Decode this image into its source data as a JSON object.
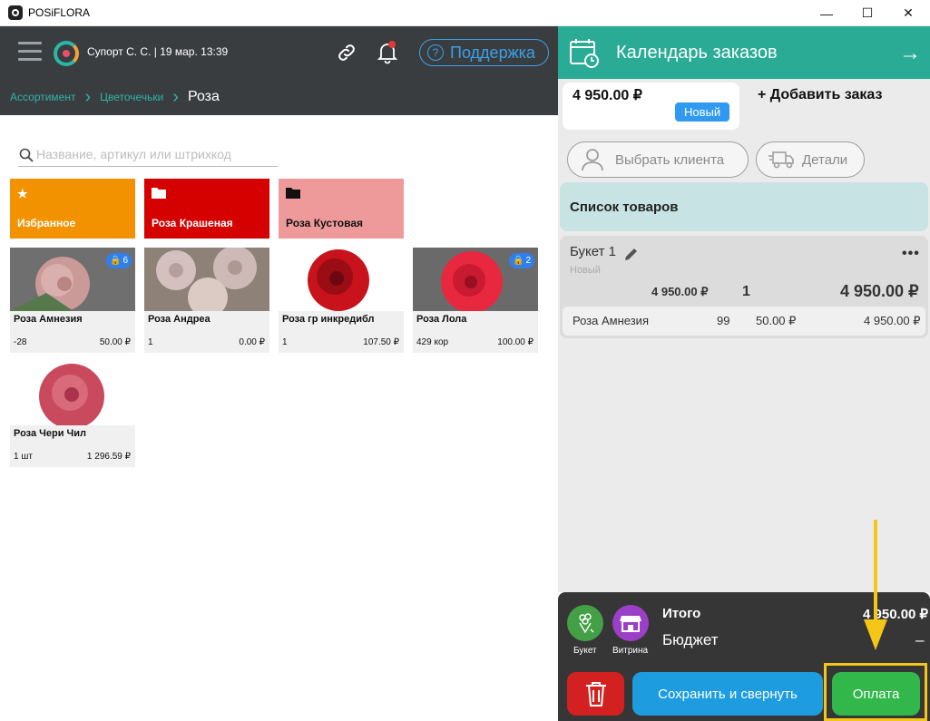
{
  "window": {
    "title": "POSiFLORA",
    "minimize": "—",
    "maximize": "☐",
    "close": "✕"
  },
  "header": {
    "user_info": "Супорт С. С. | 19 мар. 13:39",
    "support_label": "Поддержка",
    "support_icon": "?"
  },
  "breadcrumb": {
    "items": [
      "Ассортимент",
      "Цветочечьки"
    ],
    "current": "Роза"
  },
  "search": {
    "placeholder": "Название, артикул или штрихкод"
  },
  "folders": [
    {
      "label": "Избранное",
      "icon": "★",
      "color": "#f39200"
    },
    {
      "label": "Роза Крашеная",
      "icon": "folder-icon",
      "color": "#d50000"
    },
    {
      "label": "Роза Кустовая",
      "icon": "folder-icon",
      "color": "#ef9a9a"
    }
  ],
  "products": [
    {
      "name": "Роза Амнезия",
      "stock": "-28",
      "price": "50.00 ₽",
      "badge": "6"
    },
    {
      "name": "Роза Андреа",
      "stock": "1",
      "price": "0.00 ₽"
    },
    {
      "name": "Роза гр инкредибл",
      "stock": "1",
      "price": "107.50 ₽"
    },
    {
      "name": "Роза Лола",
      "stock": "429 кор",
      "price": "100.00 ₽",
      "badge": "2"
    },
    {
      "name": "Роза Чери Чил",
      "stock": "1 шт",
      "price": "1 296.59 ₽"
    }
  ],
  "orders_panel": {
    "title": "Календарь заказов",
    "order_total": "4 950.00 ₽",
    "order_status": "Новый",
    "add_order": "+ Добавить заказ",
    "client_button": "Выбрать клиента",
    "details_button": "Детали",
    "products_header": "Список товаров",
    "bouquet": {
      "name": "Букет 1",
      "status": "Новый",
      "more": "•••",
      "price": "4 950.00 ₽",
      "qty": "1",
      "total": "4 950.00 ₽",
      "line": {
        "name": "Роза Амнезия",
        "qty": "99",
        "price": "50.00 ₽",
        "sum": "4 950.00 ₽"
      }
    }
  },
  "footer": {
    "bouquet_label": "Букет",
    "showcase_label": "Витрина",
    "total_label": "Итого",
    "total_value": "4 950.00 ₽",
    "budget_label": "Бюджет",
    "budget_value": "–",
    "save_button": "Сохранить и свернуть",
    "pay_button": "Оплата"
  },
  "colors": {
    "accent": "#29ab96",
    "pay": "#32b84a",
    "save": "#1e9ce0",
    "delete": "#d32121",
    "highlight": "#f5c518"
  }
}
